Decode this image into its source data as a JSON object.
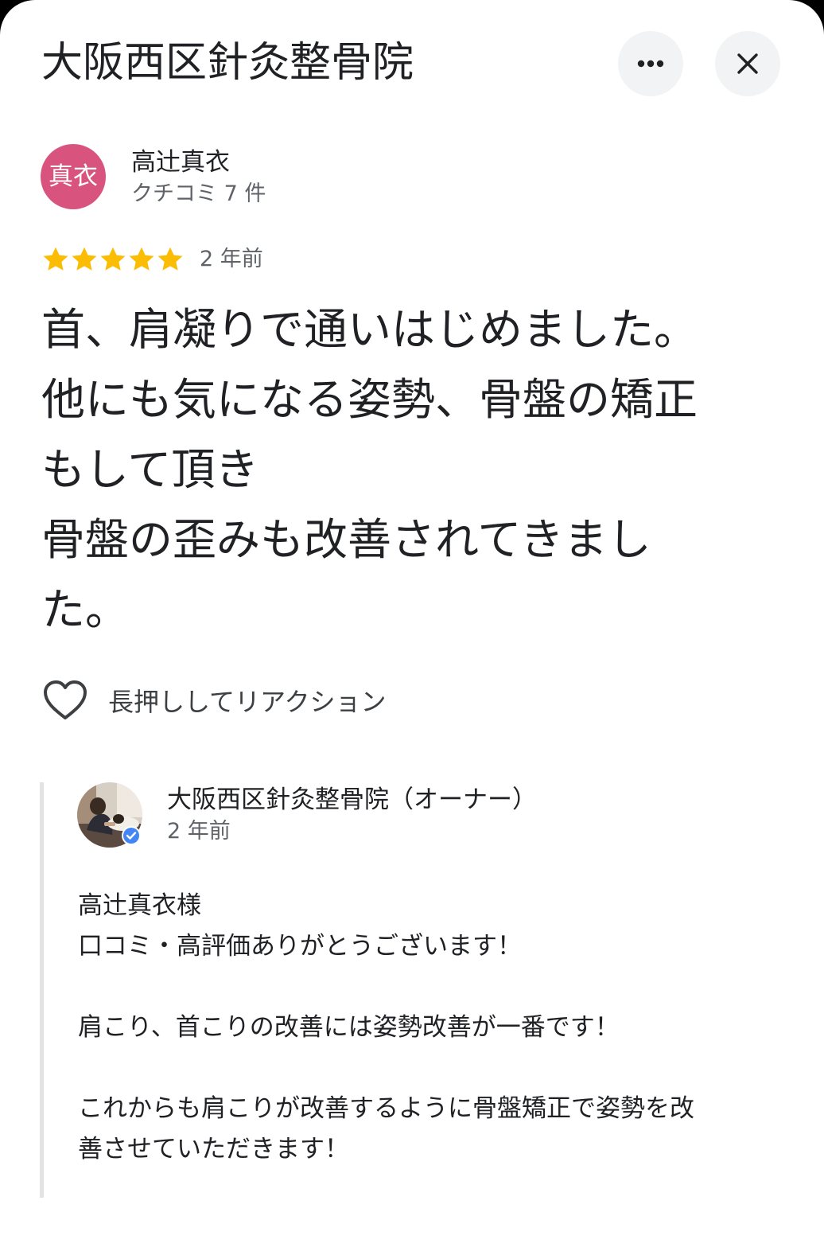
{
  "header": {
    "title": "大阪西区針灸整骨院",
    "more_icon": "more-horizontal-icon",
    "close_icon": "close-icon"
  },
  "review": {
    "avatar_text": "真衣",
    "avatar_color": "#d9537f",
    "reviewer_name": "高辻真衣",
    "review_count": "クチコミ 7 件",
    "rating": 5,
    "star_color": "#fbbc04",
    "time": "2 年前",
    "text": "首、肩凝りで通いはじめました。\n他にも気になる姿勢、骨盤の矯正\nもして頂き\n骨盤の歪みも改善されてきまし\nた。",
    "reaction_label": "長押ししてリアクション",
    "reaction_icon": "heart-outline-icon"
  },
  "owner_reply": {
    "name": "大阪西区針灸整骨院（オーナー）",
    "time": "2 年前",
    "verified_icon": "verified-badge-icon",
    "verified_color": "#4285f4",
    "text": "高辻真衣様\n口コミ・高評価ありがとうございます！\n\n肩こり、首こりの改善には姿勢改善が一番です！\n\nこれからも肩こりが改善するように骨盤矯正で姿勢を改\n善させていただきます！"
  }
}
